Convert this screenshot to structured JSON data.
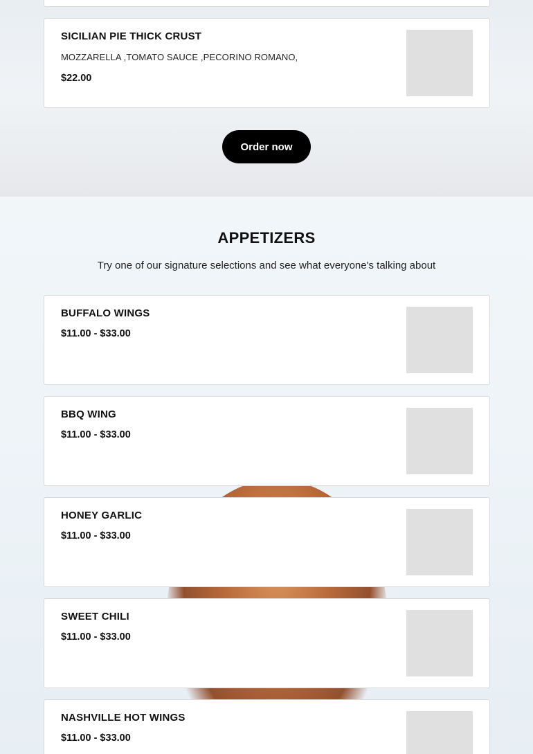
{
  "pizza": {
    "items": [
      {
        "name": "SICILIAN PIE THICK CRUST",
        "description": "MOZZARELLA ,TOMATO SAUCE ,PECORINO ROMANO,",
        "price": "$22.00"
      }
    ],
    "order_label": "Order now"
  },
  "appetizers": {
    "title": "APPETIZERS",
    "subtitle": "Try one of our signature selections and see what everyone's talking about",
    "items": [
      {
        "name": "BUFFALO WINGS",
        "price": "$11.00 - $33.00"
      },
      {
        "name": "BBQ WING",
        "price": "$11.00 - $33.00"
      },
      {
        "name": "HONEY GARLIC",
        "price": "$11.00 - $33.00"
      },
      {
        "name": "SWEET CHILI",
        "price": "$11.00 - $33.00"
      },
      {
        "name": "NASHVILLE HOT WINGS",
        "price": "$11.00 - $33.00"
      }
    ]
  },
  "colors": {
    "button_bg": "#000000",
    "button_text": "#ffffff",
    "thumb_placeholder": "#e0e0e0"
  }
}
